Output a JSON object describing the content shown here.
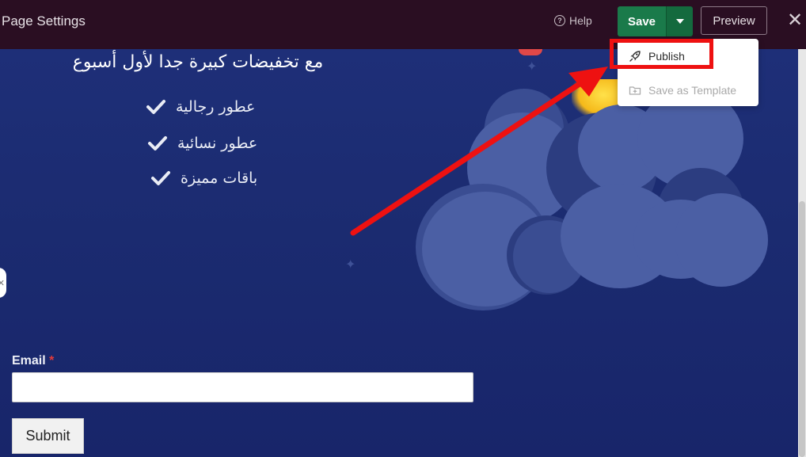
{
  "topbar": {
    "title": "Page Settings",
    "help_label": "Help",
    "save_label": "Save",
    "preview_label": "Preview"
  },
  "dropdown": {
    "items": [
      {
        "label": "Publish",
        "icon": "rocket-icon",
        "enabled": true
      },
      {
        "label": "Save as Template",
        "icon": "folder-plus-icon",
        "enabled": false
      }
    ]
  },
  "page": {
    "headline": "مع تخفيضات كبيرة جدا لأول أسبوع",
    "features": [
      "عطور رجالية",
      "عطور نسائية",
      "باقات مميزة"
    ],
    "form": {
      "email_label": "Email",
      "required_mark": "*",
      "email_value": "",
      "submit_label": "Submit"
    }
  },
  "colors": {
    "topbar_bg": "#2a0e22",
    "save_green": "#1a7a4a",
    "canvas_bg": "#1e2f78",
    "highlight_red": "#ee1111"
  }
}
